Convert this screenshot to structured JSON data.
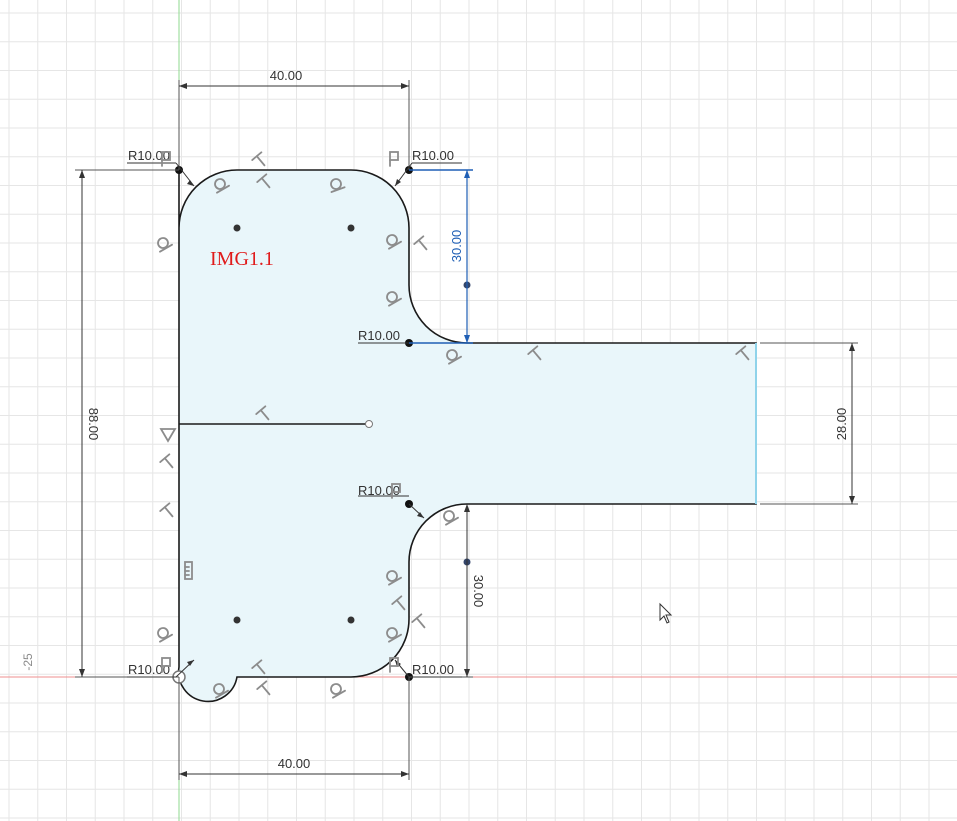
{
  "sketch": {
    "label": "IMG1.1",
    "label_color": "#e01b1b",
    "profile_fill": "#e9f6fa",
    "profile_stroke": "#1a1a1a",
    "grid_color": "#e4e4e4",
    "x_axis_color": "#ef8f8f",
    "y_axis_color": "#8fd98f",
    "driven_dimension_color": "#1f5fb5",
    "cursor_icon": "arrow-cursor-icon"
  },
  "axis": {
    "y_marker": "-25"
  },
  "dimensions": {
    "top_width": "40.00",
    "bottom_width": "40.00",
    "overall_height": "88.00",
    "upper_step_height": "30.00",
    "lower_step_height": "30.00",
    "tab_height": "28.00"
  },
  "radii": {
    "top_left": "R10.00",
    "top_right": "R10.00",
    "inner_upper": "R10.00",
    "inner_lower": "R10.00",
    "bottom_left": "R10.00",
    "bottom_right": "R10.00"
  },
  "constraint_icons": [
    "tangent-constraint-icon",
    "horizontal-constraint-icon",
    "vertical-constraint-icon",
    "fix-constraint-icon",
    "midpoint-constraint-icon",
    "coincident-constraint-icon"
  ]
}
